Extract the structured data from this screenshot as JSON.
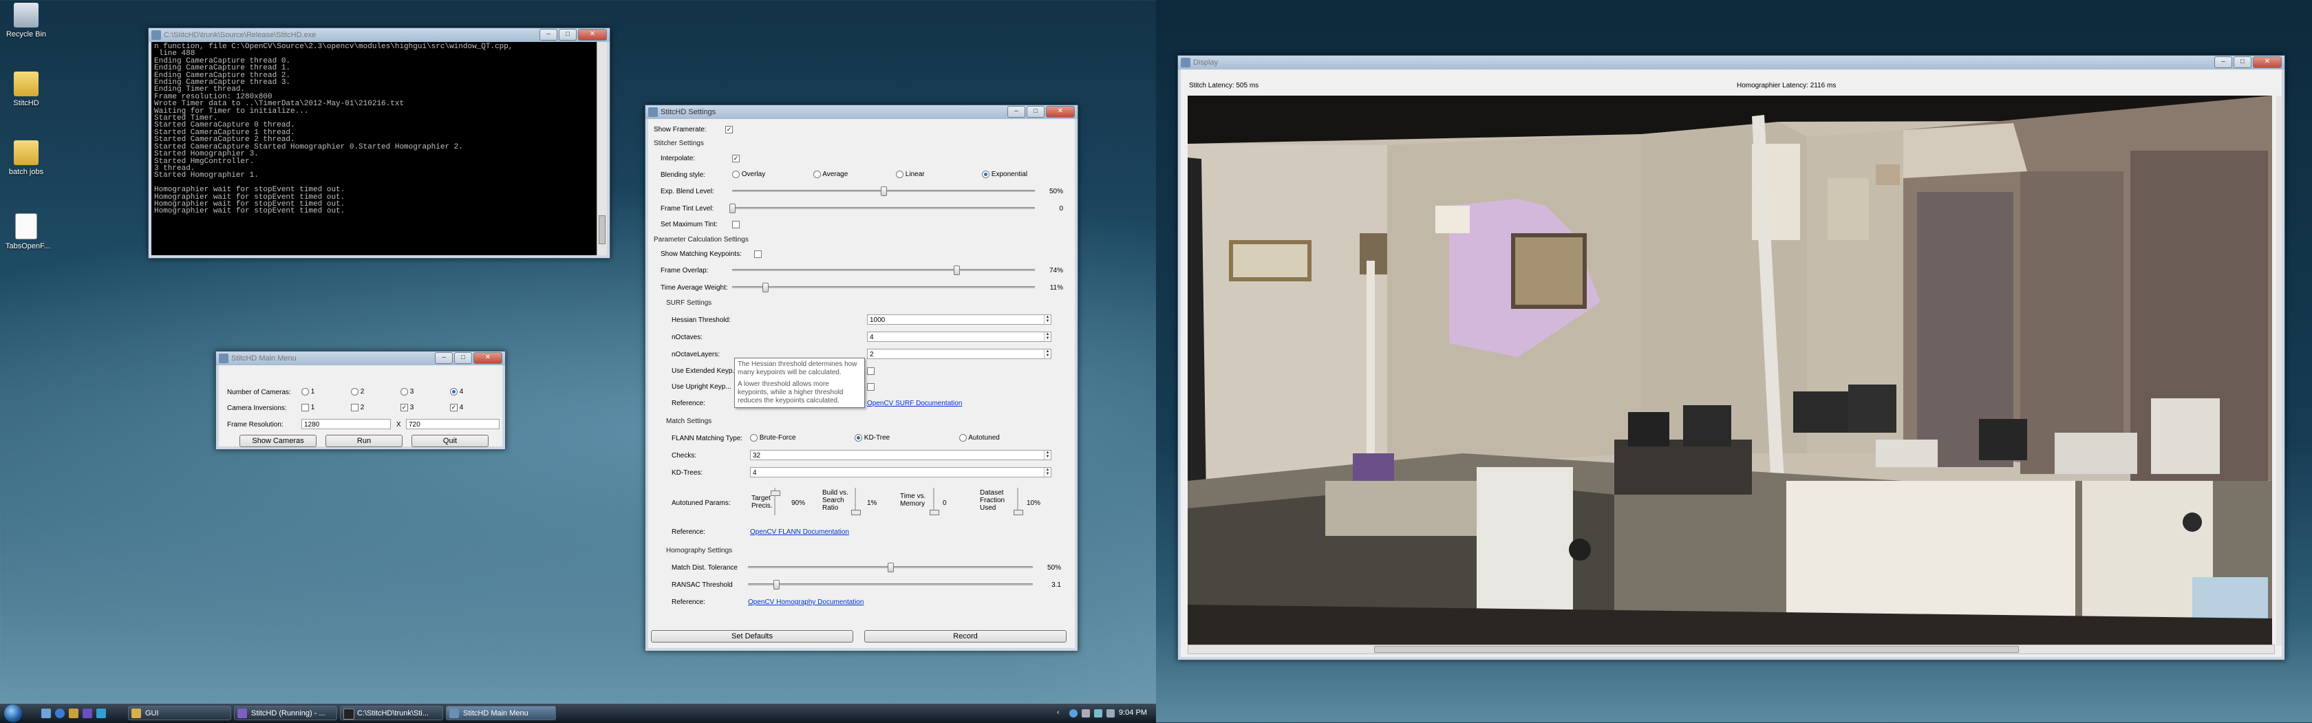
{
  "desktop": {
    "icons": [
      {
        "label": "Recycle Bin",
        "icon": "recycle-bin-icon"
      },
      {
        "label": "StitcHD",
        "icon": "folder-icon"
      },
      {
        "label": "batch jobs",
        "icon": "folder-icon"
      },
      {
        "label": "TabsOpenF...",
        "icon": "document-icon"
      }
    ]
  },
  "console_window": {
    "title": "C:\\StitcHD\\trunk\\Source\\Release\\StitcHD.exe",
    "lines": [
      "n function, file C:\\OpenCV\\Source\\2.3\\opencv\\modules\\highgui\\src\\window_QT.cpp,",
      " line 488",
      "Ending CameraCapture thread 0.",
      "Ending CameraCapture thread 1.",
      "Ending CameraCapture thread 2.",
      "Ending CameraCapture thread 3.",
      "Ending Timer thread.",
      "Frame resolution: 1280x800",
      "Wrote Timer data to ..\\TimerData\\2012-May-01\\210216.txt",
      "Waiting for Timer to initialize...",
      "Started Timer.",
      "Started CameraCapture 0 thread.",
      "Started CameraCapture 1 thread.",
      "Started CameraCapture 2 thread.",
      "Started CameraCapture Started Homographier 0.Started Homographier 2.",
      "Started Homographier 3.",
      "Started HmgController.",
      "3 thread.",
      "Started Homographier 1.",
      "",
      "Homographier wait for stopEvent timed out.",
      "Homographier wait for stopEvent timed out.",
      "Homographier wait for stopEvent timed out.",
      "Homographier wait for stopEvent timed out."
    ]
  },
  "main_menu": {
    "title": "StitcHD Main Menu",
    "num_cameras_label": "Number of Cameras:",
    "num_cameras_options": [
      "1",
      "2",
      "3",
      "4"
    ],
    "num_cameras_selected": "4",
    "inversion_label": "Camera Inversions:",
    "inversion_options": [
      "1",
      "2",
      "3",
      "4"
    ],
    "inversion_checked": [
      "3",
      "4"
    ],
    "resolution_label": "Frame Resolution:",
    "res_width": "1280",
    "res_x": "X",
    "res_height": "720",
    "show_cameras": "Show Cameras",
    "run": "Run",
    "quit": "Quit"
  },
  "settings": {
    "title": "StitcHD Settings",
    "show_framerate": "Show Framerate:",
    "stitcher_settings": "Stitcher Settings",
    "interpolate": "Interpolate:",
    "blending_style": "Blending style:",
    "blend_options": [
      "Overlay",
      "Average",
      "Linear",
      "Exponential"
    ],
    "blend_selected": "Exponential",
    "exp_blend_level": "Exp. Blend Level:",
    "exp_blend_value": "50%",
    "exp_blend_fraction": 0.5,
    "frame_tint_level": "Frame Tint Level:",
    "frame_tint_value": "0",
    "frame_tint_fraction": 0.0,
    "set_max_tint": "Set Maximum Tint:",
    "param_calc": "Parameter Calculation Settings",
    "show_matching": "Show Matching Keypoints:",
    "frame_overlap": "Frame Overlap:",
    "frame_overlap_value": "74%",
    "frame_overlap_fraction": 0.74,
    "time_avg_weight": "Time Average Weight:",
    "time_avg_value": "11%",
    "time_avg_fraction": 0.11,
    "surf_settings": "SURF Settings",
    "hessian": "Hessian Threshold:",
    "hessian_value": "1000",
    "noctaves": "nOctaves:",
    "noctaves_value": "4",
    "noctave_layers": "nOctaveLayers:",
    "noctave_layers_value": "2",
    "use_extended": "Use Extended Keyp...",
    "use_upright": "Use Upright Keyp...",
    "reference": "Reference:",
    "surf_link": "OpenCV SURF Documentation",
    "tooltip_p1": "The Hessian threshold determines how many keypoints will be calculated.",
    "tooltip_p2": "A lower threshold allows more keypoints, while a higher threshold reduces the keypoints calculated.",
    "match_settings": "Match Settings",
    "flann_type": "FLANN Matching Type:",
    "flann_options": [
      "Brute-Force",
      "KD-Tree",
      "Autotuned"
    ],
    "flann_selected": "KD-Tree",
    "checks": "Checks:",
    "checks_value": "32",
    "kd_trees": "KD-Trees:",
    "kd_trees_value": "4",
    "autotuned_params": "Autotuned Params:",
    "target_precis": "Target Precis.",
    "target_precis_value": "90%",
    "build_vs_search": "Build vs. Search Ratio",
    "build_vs_search_value": "1%",
    "time_vs_memory": "Time vs. Memory",
    "time_vs_memory_value": "0",
    "dataset_fraction": "Dataset Fraction Used",
    "dataset_fraction_value": "10%",
    "flann_link": "OpenCV FLANN Documentation",
    "homography_settings": "Homography Settings",
    "match_dist": "Match Dist. Tolerance",
    "match_dist_value": "50%",
    "match_dist_fraction": 0.5,
    "ransac": "RANSAC Threshold",
    "ransac_value": "3.1",
    "ransac_fraction": 0.1,
    "homography_link": "OpenCV Homography Documentation",
    "set_defaults": "Set Defaults",
    "record": "Record"
  },
  "display": {
    "title": "Display",
    "stitch_latency": "Stitch Latency: 505 ms",
    "homographier_latency": "Homographier Latency: 2116 ms"
  },
  "taskbar": {
    "items": [
      "GUI",
      "StitcHD (Running) - ...",
      "C:\\StitcHD\\trunk\\Sti...",
      "StitcHD Main Menu"
    ],
    "active": "StitcHD Main Menu",
    "clock": "9:04 PM"
  },
  "colors": {
    "accent": "#2a6bc4",
    "link": "#0033cc"
  }
}
